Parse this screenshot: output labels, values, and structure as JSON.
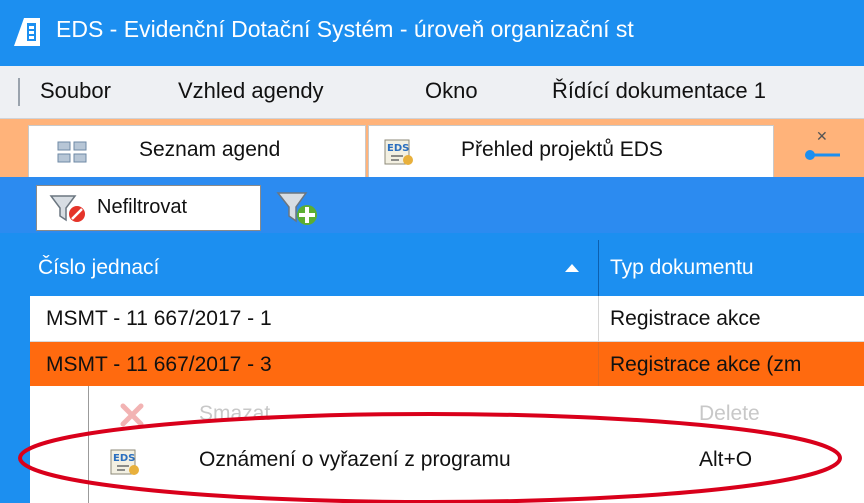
{
  "window": {
    "title": "EDS - Evidenční Dotační Systém - úroveň organizační st"
  },
  "menu": [
    "Soubor",
    "Vzhled agendy",
    "Okno",
    "Řídící dokumentace 1"
  ],
  "tabs": [
    {
      "label": "Seznam agend",
      "icon": "grid-icon"
    },
    {
      "label": "Přehled projektů EDS",
      "icon": "eds-icon"
    }
  ],
  "toolbar": {
    "filter_button_label": "Nefiltrovat",
    "add_filter_icon": "add-filter-icon"
  },
  "grid": {
    "columns": [
      "Číslo jednací",
      "Typ dokumentu"
    ],
    "rows": [
      [
        "MSMT - 11 667/2017 - 1",
        "Registrace akce"
      ],
      [
        "MSMT - 11 667/2017 - 3",
        "Registrace akce (zm"
      ]
    ],
    "selected_row_index": 1
  },
  "context_menu": {
    "items": [
      {
        "label": "Smazat",
        "shortcut": "Delete",
        "enabled": false,
        "icon": "delete-icon"
      },
      {
        "label": "Oznámení o vyřazení z programu",
        "shortcut": "Alt+O",
        "enabled": true,
        "icon": "eds-icon"
      }
    ]
  },
  "colors": {
    "accent_blue": "#1c8ff0",
    "selected_row": "#ff6a0f",
    "tab_strip": "#ffb37a",
    "annotation_red": "#d9001b"
  }
}
